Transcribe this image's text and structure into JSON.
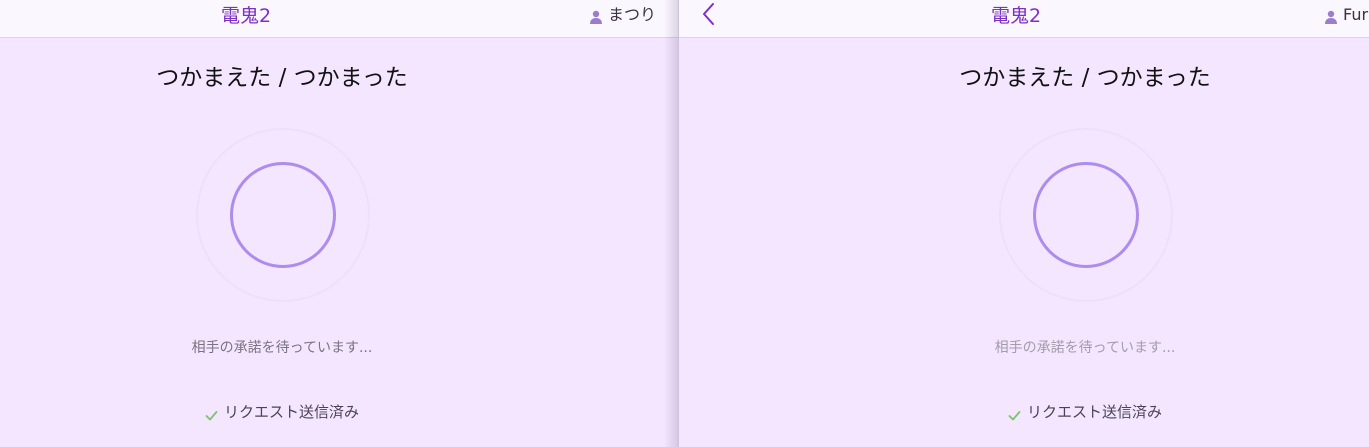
{
  "colors": {
    "background": "#f4e6ff",
    "topbar": "#fbf7fe",
    "brand": "#7e2fc4",
    "user_icon": "#9b7ecb",
    "spinner_ring": "#ad8cec",
    "check": "#7cc46a"
  },
  "left_window": {
    "app_title": "電鬼2",
    "user_icon": "person-icon",
    "username": "まつり",
    "heading": "つかまえた / つかまった",
    "waiting_text": "相手の承諾を待っています...",
    "status_icon": "check-icon",
    "status_text": "リクエスト送信済み"
  },
  "right_window": {
    "back_icon": "chevron-left-icon",
    "app_title": "電鬼2",
    "user_icon": "person-icon",
    "username": "Fur",
    "heading": "つかまえた / つかまった",
    "waiting_text": "相手の承諾を待っています...",
    "status_icon": "check-icon",
    "status_text": "リクエスト送信済み"
  }
}
